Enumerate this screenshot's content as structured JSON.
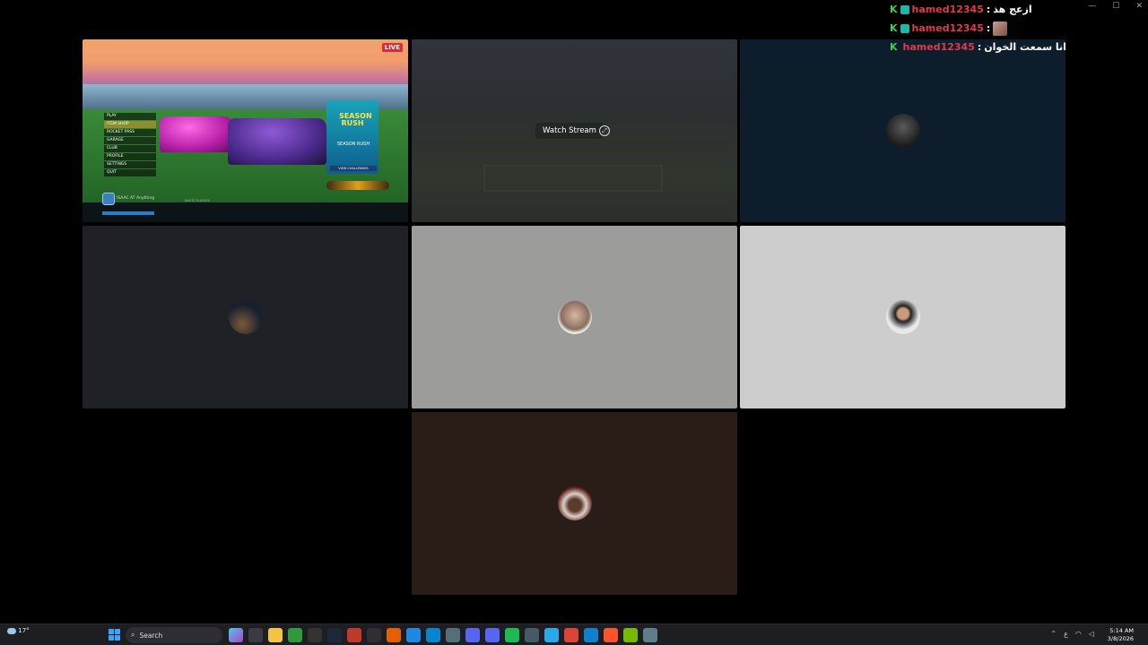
{
  "window": {
    "controls": [
      "—",
      "☐",
      "✕"
    ]
  },
  "chat": [
    {
      "user": "hamed12345",
      "separator": ":",
      "message": "ازعج هذ",
      "emote": false
    },
    {
      "user": "hamed12345",
      "separator": ":",
      "message": "",
      "emote": true
    },
    {
      "user": "hamed12345",
      "separator": ":",
      "message": "انا سمعت الخوان",
      "emote": false
    }
  ],
  "tiles": {
    "game": {
      "live_label": "LIVE",
      "menu_items": [
        "PLAY",
        "ITEM SHOP",
        "ROCKET PASS",
        "GARAGE",
        "CLUB",
        "PROFILE",
        "SETTINGS",
        "QUIT"
      ],
      "promo_title": "SEASON RUSH",
      "promo_sub": "SEASON RUSH",
      "promo_button": "VIEW CHALLENGES",
      "player_name": "ISAAC AT Anything",
      "party_label": "INVITE PLAYERS"
    },
    "stream": {
      "watch_label": "Watch Stream"
    }
  },
  "colors": {
    "tile_dark_blue": "#0e1d2b",
    "tile_charcoal": "#1f2126",
    "tile_grey": "#9c9c9a",
    "tile_light": "#cdcdcd",
    "tile_brown": "#2a1c17"
  },
  "taskbar": {
    "weather": "17°",
    "search_placeholder": "Search",
    "time": "5:14 AM",
    "date": "3/8/2026",
    "tray_lang": "ع"
  }
}
